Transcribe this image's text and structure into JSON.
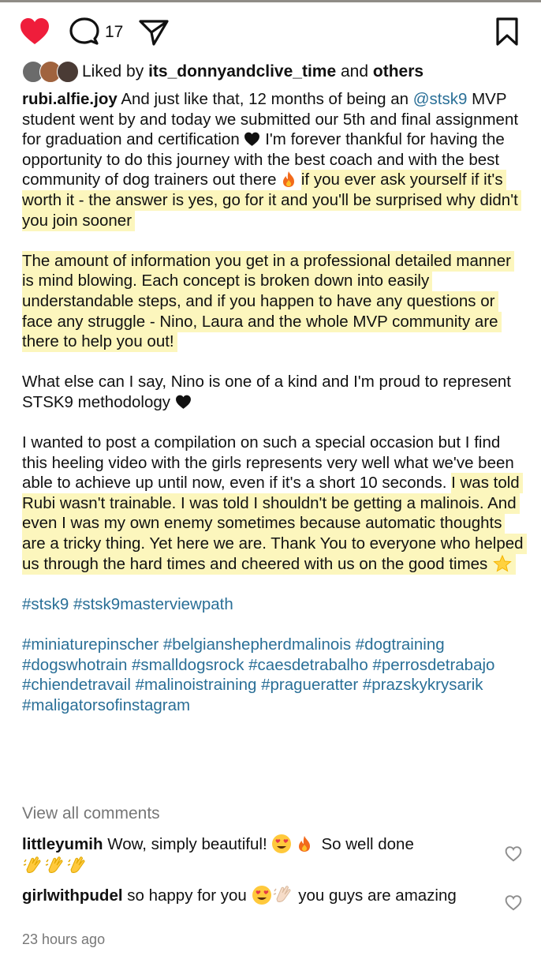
{
  "actions": {
    "comment_count": "17"
  },
  "likes": {
    "prefix": "Liked by",
    "user": "its_donnyandclive_time",
    "conj": "and",
    "others": "others"
  },
  "caption": {
    "username": "rubi.alfie.joy",
    "p1_a": "And just like that, 12 months of being an",
    "mention": "@stsk9",
    "p1_b": "MVP student went by and today we submitted our 5th and final assignment for graduation and certification",
    "p1_c": "I'm forever thankful for having the opportunity to do this journey with the best coach and with the best community of dog trainers out there",
    "p1_hl": "if you ever ask yourself if it's worth it - the answer is yes, go for it and you'll be surprised why didn't you join sooner",
    "p2_hl": "The amount of information you get in a professional detailed manner is mind blowing. Each concept is broken down into easily understandable steps, and if you happen to have any questions or face any struggle - Nino, Laura and the whole MVP community are there to help you out!",
    "p3": "What else can I say, Nino is one of a kind and I'm proud to represent STSK9 methodology",
    "p4_a": "I wanted to post a compilation on such a special occasion but I find this heeling video with the girls represents very well what we've been able to achieve up until now, even if it's a short 10 seconds.",
    "p4_hl": "I was told Rubi wasn't trainable. I was told I shouldn't be getting a malinois. And even I was my own enemy sometimes because automatic thoughts are a tricky thing. Yet here we are. Thank You to everyone who helped us through the hard times and cheered with us on the good times",
    "tags1": "#stsk9 #stsk9masterviewpath",
    "tags2": "#miniaturepinscher #belgianshepherdmalinois #dogtraining #dogswhotrain #smalldogsrock #caesdetrabalho #perrosdetrabajo #chiendetravail #malinoistraining #prагueratter #prazskykrysarik #maligatorsofinstagram"
  },
  "view_all": "View all comments",
  "comments": [
    {
      "user": "littleyumih",
      "text_a": "Wow, simply beautiful!",
      "text_b": "So well done"
    },
    {
      "user": "girlwithpudel",
      "text_a": "so happy for you",
      "text_b": "you guys are amazing"
    }
  ],
  "timestamp": "23 hours ago",
  "colors": {
    "like": "#ef1d3b",
    "link": "#2a6f97",
    "highlight": "#fcf6bd"
  }
}
